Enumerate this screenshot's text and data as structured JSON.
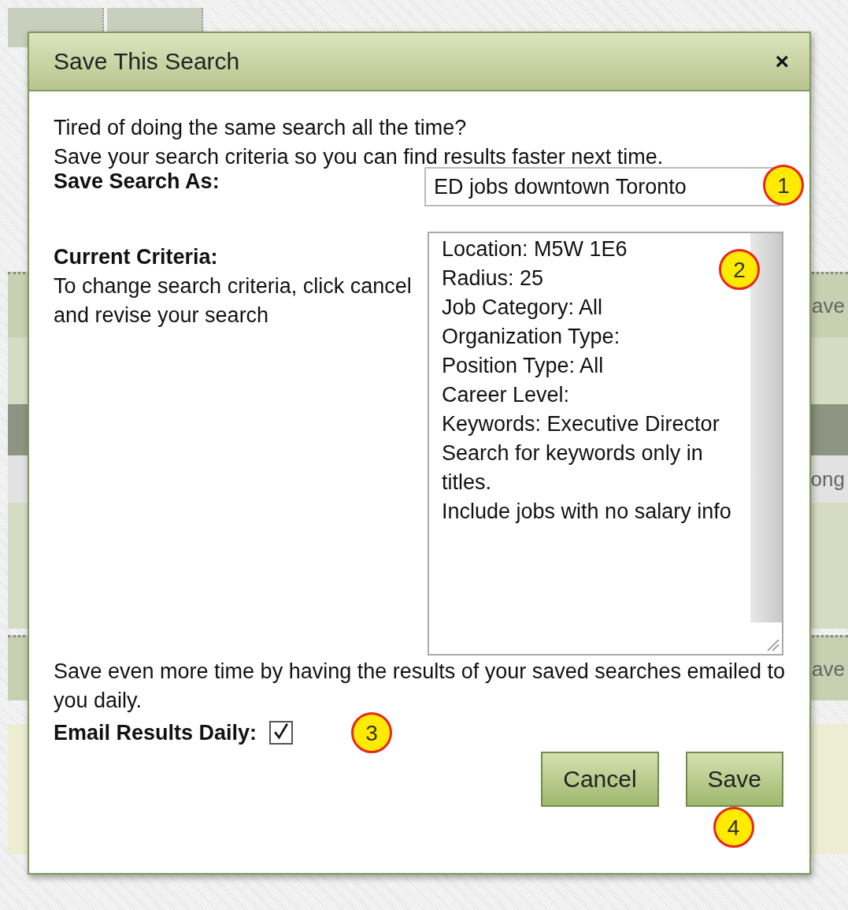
{
  "window": {
    "title": "Save This Search",
    "close": "×"
  },
  "intro": [
    "Tired of doing the same search all the time?",
    "Save your search criteria so you can find results faster next time."
  ],
  "save_as": {
    "label": "Save Search As:",
    "value": "ED jobs downtown Toronto"
  },
  "criteria": {
    "label": "Current Criteria:",
    "hint": "To change search criteria, click cancel and revise your search",
    "lines": [
      "Location: M5W 1E6",
      "Radius: 25",
      "Job Category: All",
      "Organization Type:",
      "Position Type: All",
      "Career Level:",
      "Keywords: Executive Director",
      "Search for keywords only in titles.",
      "Include jobs with no salary info"
    ]
  },
  "email": {
    "note": "Save even more time by having the results of your saved searches emailed to you daily.",
    "label": "Email Results Daily:",
    "checked": true
  },
  "buttons": [
    {
      "label": "Cancel"
    },
    {
      "label": "Save"
    }
  ],
  "callouts": [
    "1",
    "2",
    "3",
    "4"
  ],
  "background": {
    "fragments": [
      "ave",
      "ong",
      "ave"
    ]
  }
}
